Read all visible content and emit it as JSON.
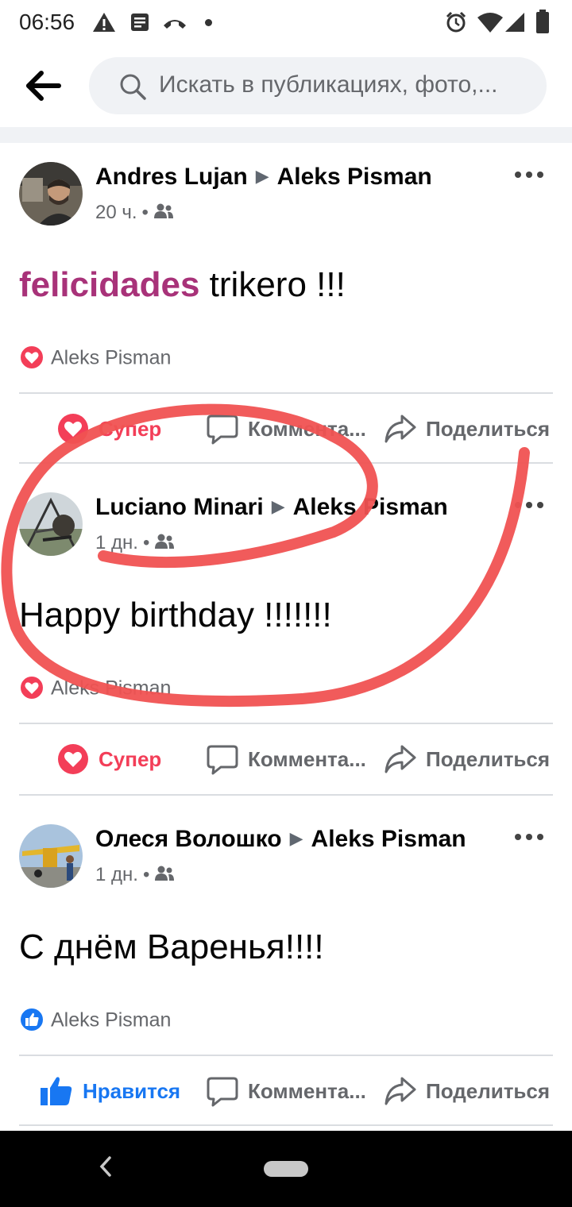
{
  "status_bar": {
    "time": "06:56",
    "left_icons": [
      "warning-icon",
      "message-icon",
      "missed-call-icon",
      "dot-icon"
    ],
    "right_icons": [
      "alarm-icon",
      "wifi-icon",
      "signal-icon",
      "battery-icon"
    ]
  },
  "header": {
    "back_icon": "back-arrow-icon",
    "search_placeholder": "Искать в публикациях, фото,..."
  },
  "colors": {
    "accent_blue": "#1877f2",
    "love_red": "#f33e58",
    "felicidades_purple": "#a83279",
    "annotation_red": "#f05252"
  },
  "posts": [
    {
      "author": "Andres Lujan",
      "target": "Aleks Pisman",
      "time": "20 ч.",
      "audience_icon": "friends-icon",
      "text_highlight": "felicidades",
      "text": " trikero !!!",
      "reaction_icon": "love-icon",
      "reaction_by": "Aleks Pisman",
      "actions": {
        "react": "Супер",
        "comment": "Коммента...",
        "share": "Поделиться"
      }
    },
    {
      "author": "Luciano Minari",
      "target": "Aleks Pisman",
      "time": "1 дн.",
      "audience_icon": "friends-icon",
      "text": "Happy birthday !!!!!!!",
      "reaction_icon": "love-icon",
      "reaction_by": "Aleks Pisman",
      "actions": {
        "react": "Супер",
        "comment": "Коммента...",
        "share": "Поделиться"
      }
    },
    {
      "author": "Олеся Волошко",
      "target": "Aleks Pisman",
      "time": "1 дн.",
      "audience_icon": "friends-icon",
      "text": "С днём Варенья!!!!",
      "reaction_icon": "like-icon",
      "reaction_by": "Aleks Pisman",
      "actions": {
        "react": "Нравится",
        "comment": "Коммента...",
        "share": "Поделиться"
      }
    }
  ],
  "nav_bar": {
    "back_icon": "nav-back-icon",
    "home_icon": "home-pill-icon"
  }
}
